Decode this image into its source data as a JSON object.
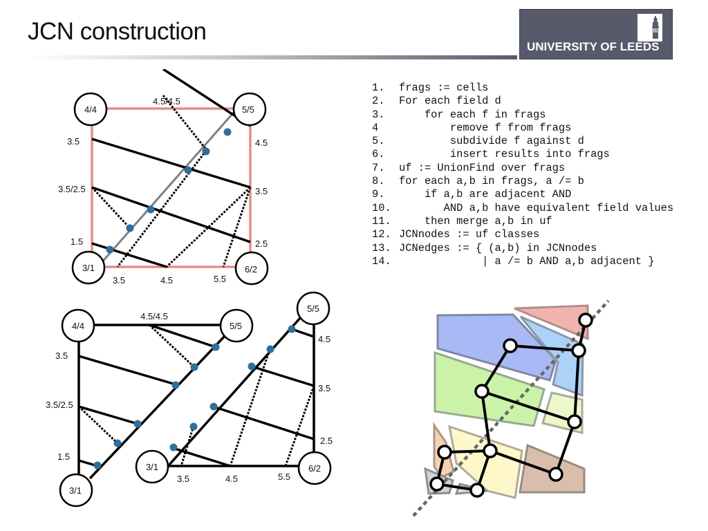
{
  "slide": {
    "title": "JCN construction",
    "logo_text": "UNIVERSITY OF LEEDS"
  },
  "algorithm": [
    {
      "num": "1.",
      "text": "frags := cells"
    },
    {
      "num": "2.",
      "text": "For each field d"
    },
    {
      "num": "3.",
      "text": "    for each f in frags"
    },
    {
      "num": "4",
      "text": "        remove f from frags"
    },
    {
      "num": "5.",
      "text": "        subdivide f against d"
    },
    {
      "num": "6.",
      "text": "        insert results into frags"
    },
    {
      "num": "7.",
      "text": "uf := UnionFind over frags"
    },
    {
      "num": "8.",
      "text": "for each a,b in frags, a /= b"
    },
    {
      "num": "9.",
      "text": "    if a,b are adjacent AND"
    },
    {
      "num": "10.",
      "text": "       AND a,b have equivalent field values"
    },
    {
      "num": "11.",
      "text": "    then merge a,b in uf"
    },
    {
      "num": "12.",
      "text": "JCNnodes := uf classes"
    },
    {
      "num": "13.",
      "text": "JCNedges := { (a,b) in JCNnodes"
    },
    {
      "num": "14.",
      "text": "             | a /= b AND a,b adjacent }"
    }
  ],
  "diagram_top": {
    "vertices": [
      "4/4",
      "5/5",
      "3/1",
      "6/2"
    ],
    "edge_labels": {
      "top": "4.5/4.5",
      "left_upper": "3.5",
      "left_mid": "3.5/2.5",
      "left_lower": "1.5",
      "right_upper": "4.5",
      "right_mid": "3.5",
      "right_lower": "2.5",
      "bottom_a": "3.5",
      "bottom_b": "4.5",
      "bottom_c": "5.5"
    }
  },
  "diagram_split": {
    "left_vertices": [
      "4/4",
      "5/5",
      "3/1"
    ],
    "right_vertices": [
      "5/5",
      "3/1",
      "6/2"
    ],
    "left_labels": {
      "top": "4.5/4.5",
      "left_upper": "3.5",
      "left_mid": "3.5/2.5",
      "left_lower": "1.5"
    },
    "right_labels": {
      "right_upper": "4.5",
      "right_mid": "3.5",
      "right_lower": "2.5",
      "bottom_a": "3.5",
      "bottom_b": "4.5",
      "bottom_c": "5.5"
    }
  },
  "colors": {
    "cell_edge": "#e38e8a",
    "intersection_dot": "#2f6f9a",
    "logo_bg": "#575a6b",
    "frag_blue": "#a9b9f5",
    "frag_lightblue": "#acd2f8",
    "frag_red": "#f2b3ae",
    "frag_green": "#cbf3a8",
    "frag_palegreen": "#ecf8cc",
    "frag_yellow": "#fdf7c9",
    "frag_orange": "#f8d2b0",
    "frag_brown": "#d9bfab",
    "frag_grey": "#d2d2d2"
  }
}
